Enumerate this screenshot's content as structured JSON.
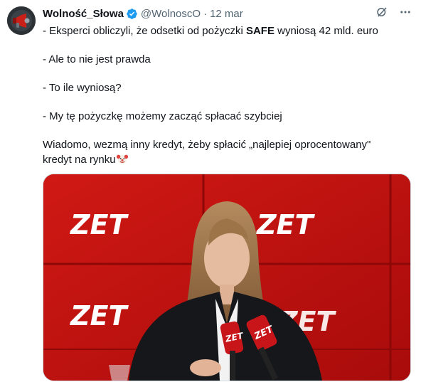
{
  "tweet": {
    "author_name": "Wolność_Słowa",
    "author_handle": "@WolnoscO",
    "date": "12 mar",
    "lines": [
      {
        "pre": "- Eksperci obliczyli, że odsetki od pożyczki ",
        "bold": "SAFE",
        "post": " wyniosą 42 mld. euro"
      },
      {
        "text": "- Ale to nie jest prawda"
      },
      {
        "text": "- To ile wyniosą?"
      },
      {
        "text": "- My tę pożyczkę możemy zacząć spłacać szybciej"
      },
      {
        "text": "Wiadomo, wezmą inny kredyt, żeby spłacić „najlepiej oprocentowany\""
      },
      {
        "text": "kredyt na rynku"
      }
    ],
    "media": {
      "logo_text": "ZET",
      "mic_text": "ZET"
    },
    "icons": [
      "verified-badge-icon",
      "grok-icon",
      "more-icon",
      "clown-emoji"
    ],
    "colors": {
      "verified": "#1d9bf0",
      "studio_red": "#c4120f",
      "text": "#0f1419",
      "secondary": "#536471"
    }
  }
}
